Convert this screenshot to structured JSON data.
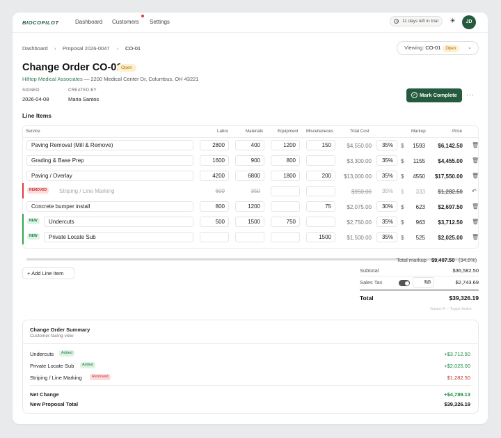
{
  "brand": {
    "logo": "BIOCOPILOT",
    "accent": "#245a3e"
  },
  "nav": {
    "items": [
      "Dashboard",
      "Customers",
      "Settings"
    ]
  },
  "topbar": {
    "trial": "11 days left in trial",
    "avatar": "JD"
  },
  "breadcrumb": {
    "items": [
      "Dashboard",
      "Proposal 2026-0047",
      "CO-01"
    ]
  },
  "viewing": {
    "label": "Viewing:",
    "value": "CO-01",
    "badge": "Open"
  },
  "header": {
    "title": "Change Order CO-01",
    "status": "Open",
    "client_name": "Hilltop Medical Associates",
    "client_address": " — 2200 Medical Center Dr, Columbus, OH 43221",
    "signed_label": "SIGNED",
    "signed_value": "2026-04-08",
    "created_label": "CREATED BY",
    "created_value": "Maria Santos",
    "mark_complete": "Mark Complete"
  },
  "line_items": {
    "title": "Line Items",
    "columns": [
      "Service",
      "Labor",
      "Materials",
      "Equipment",
      "Miscellaneous",
      "Total Cost",
      "Markup",
      "Price"
    ],
    "rows": [
      {
        "service": "Paving Removal (Mill & Remove)",
        "labor": "2800",
        "materials": "400",
        "equipment": "1200",
        "misc": "150",
        "total": "$4,550.00",
        "pct": "35%",
        "cur": "$",
        "markup": "1593",
        "price": "$6,142.50",
        "tag": ""
      },
      {
        "service": "Grading & Base Prep",
        "labor": "1600",
        "materials": "900",
        "equipment": "800",
        "misc": "",
        "total": "$3,300.00",
        "pct": "35%",
        "cur": "$",
        "markup": "1155",
        "price": "$4,455.00",
        "tag": ""
      },
      {
        "service": "Paving / Overlay",
        "labor": "4200",
        "materials": "6800",
        "equipment": "1800",
        "misc": "200",
        "total": "$13,000.00",
        "pct": "35%",
        "cur": "$",
        "markup": "4550",
        "price": "$17,550.00",
        "tag": ""
      },
      {
        "service": "Striping / Line Marking",
        "labor": "600",
        "materials": "350",
        "equipment": "",
        "misc": "",
        "total": "$950.00",
        "pct": "35%",
        "cur": "$",
        "markup": "333",
        "price": "$1,282.50",
        "tag": "REMOVED"
      },
      {
        "service": "Concrete bumper install",
        "labor": "800",
        "materials": "1200",
        "equipment": "",
        "misc": "75",
        "total": "$2,075.00",
        "pct": "30%",
        "cur": "$",
        "markup": "623",
        "price": "$2,697.50",
        "tag": ""
      },
      {
        "service": "Undercuts",
        "labor": "500",
        "materials": "1500",
        "equipment": "750",
        "misc": "",
        "total": "$2,750.00",
        "pct": "35%",
        "cur": "$",
        "markup": "963",
        "price": "$3,712.50",
        "tag": "NEW"
      },
      {
        "service": "Private Locate Sub",
        "labor": "",
        "materials": "",
        "equipment": "",
        "misc": "1500",
        "total": "$1,500.00",
        "pct": "35%",
        "cur": "$",
        "markup": "525",
        "price": "$2,025.00",
        "tag": "NEW"
      }
    ],
    "add_button": "Add Line Item"
  },
  "totals": {
    "markup_label": "Total markup",
    "markup_value": "$9,407.50",
    "markup_pct": "(34.6%)",
    "subtotal_label": "Subtotal",
    "subtotal_value": "$36,582.50",
    "tax_label": "Sales Tax",
    "tax_rate": "7.5",
    "tax_unit": "%",
    "tax_value": "$2,743.69",
    "total_label": "Total",
    "total_value": "$39,326.19",
    "variant_note": "Variant: A — Toggle Switch"
  },
  "summary": {
    "title": "Change Order Summary",
    "subtitle": "Customer-facing view",
    "items": [
      {
        "name": "Undercuts",
        "badge": "Added",
        "amount": "+$3,712.50"
      },
      {
        "name": "Private Locate Sub",
        "badge": "Added",
        "amount": "+$2,025.00"
      },
      {
        "name": "Striping / Line Marking",
        "badge": "Removed",
        "amount": "$1,282.50"
      }
    ],
    "net_label": "Net Change",
    "net_value": "+$4,789.13",
    "new_total_label": "New Proposal Total",
    "new_total_value": "$39,326.19"
  },
  "colors": {
    "positive": "#1f8a45",
    "negative": "#c43333",
    "removed_bar": "#e03b3b",
    "new_bar": "#2fa84f"
  }
}
